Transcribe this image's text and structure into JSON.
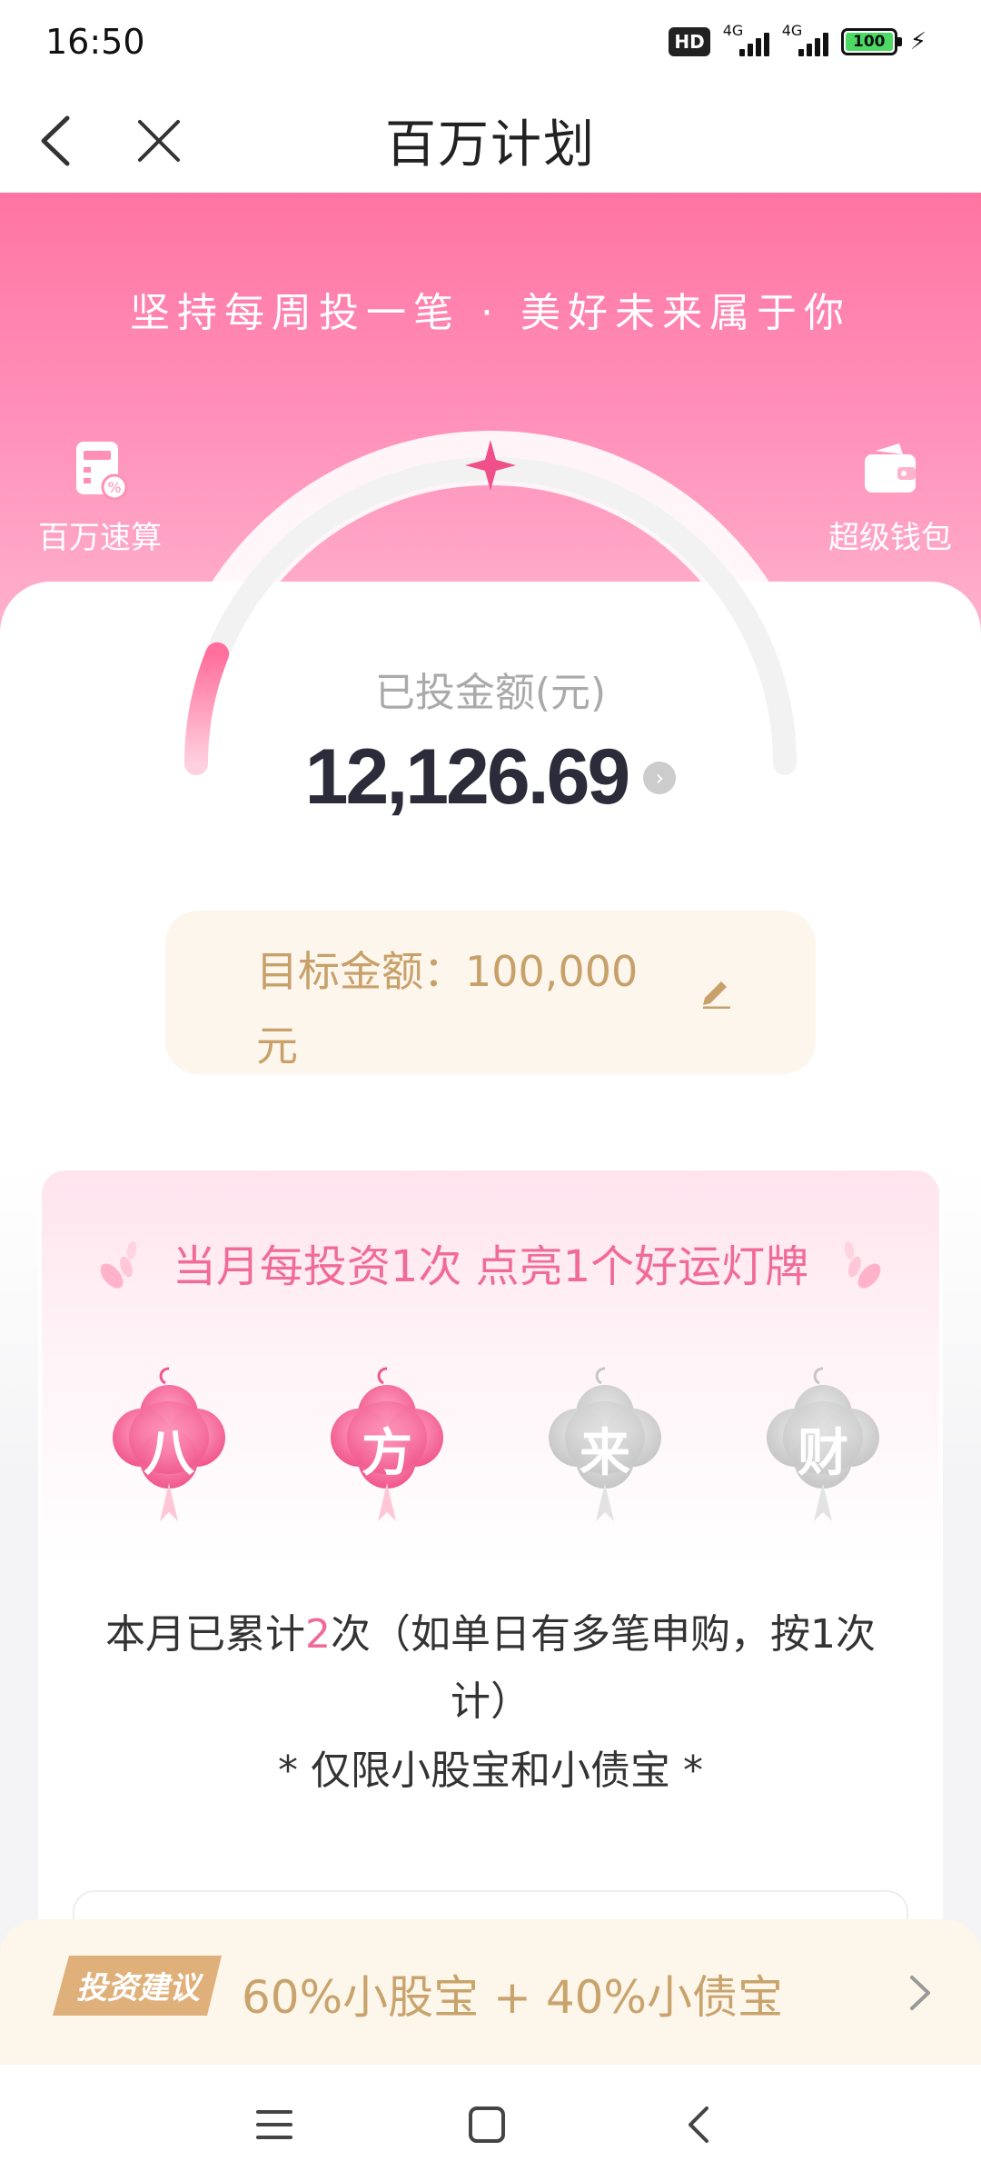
{
  "status_bar": {
    "time": "16:50",
    "hd": "HD",
    "network_1": "4G",
    "network_2": "4G",
    "battery": "100"
  },
  "nav": {
    "title": "百万计划",
    "back_icon": "chevron-left-icon",
    "close_icon": "close-icon"
  },
  "hero": {
    "slogan": "坚持每周投一笔 · 美好未来属于你",
    "shortcut_left": {
      "label": "百万速算",
      "icon": "calculator-icon"
    },
    "shortcut_right": {
      "label": "超级钱包",
      "icon": "wallet-icon"
    }
  },
  "progress": {
    "label": "已投金额(元)",
    "value": "12,126.69",
    "fraction": 0.121
  },
  "target": {
    "text_line1": "目标金额：100,000",
    "text_line2": "元"
  },
  "lucky": {
    "title": "当月每投资1次 点亮1个好运灯牌",
    "lamps": [
      {
        "char": "八",
        "lit": true
      },
      {
        "char": "方",
        "lit": true
      },
      {
        "char": "来",
        "lit": false
      },
      {
        "char": "财",
        "lit": false
      }
    ],
    "count_prefix": "本月已累计",
    "count_value": "2",
    "count_suffix": "次（如单日有多笔申购，按1次计）",
    "limit_note": "* 仅限小股宝和小债宝 *"
  },
  "advice": {
    "tag": "投资建议",
    "text": "60%小股宝 + 40%小债宝"
  },
  "colors": {
    "accent_pink": "#f06b98",
    "gold": "#c7a06a"
  }
}
